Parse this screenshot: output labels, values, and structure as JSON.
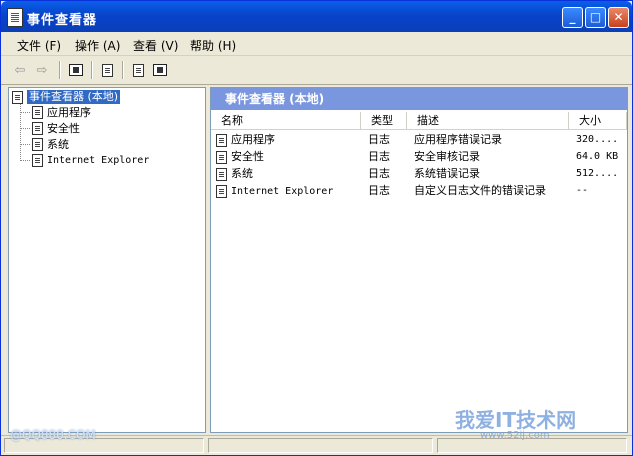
{
  "window": {
    "title": "事件查看器",
    "controls": [
      "_",
      "□",
      "✕"
    ]
  },
  "menu": [
    {
      "label": "文件 (F)"
    },
    {
      "label": "操作 (A)"
    },
    {
      "label": "查看 (V)"
    },
    {
      "label": "帮助 (H)"
    }
  ],
  "toolbar": {
    "back_glyph": "⇦",
    "forward_glyph": "⇨"
  },
  "tree": {
    "root": "事件查看器 (本地)",
    "children": [
      "应用程序",
      "安全性",
      "系统",
      "Internet Explorer"
    ]
  },
  "right_pane": {
    "header": "事件查看器 (本地)",
    "columns": [
      "名称",
      "类型",
      "描述",
      "大小"
    ],
    "rows": [
      {
        "name": "应用程序",
        "type": "日志",
        "desc": "应用程序错误记录",
        "size": "320...."
      },
      {
        "name": "安全性",
        "type": "日志",
        "desc": "安全审核记录",
        "size": "64.0 KB"
      },
      {
        "name": "系统",
        "type": "日志",
        "desc": "系统错误记录",
        "size": "512...."
      },
      {
        "name": "Internet Explorer",
        "type": "日志",
        "desc": "自定义日志文件的错误记录",
        "size": "--"
      }
    ]
  },
  "watermarks": {
    "left": "@QQ880.COM",
    "right": "我爱IT技术网",
    "right_sub": "www.52ij.com"
  },
  "colors": {
    "titlebar": "#0a5ee8",
    "selection": "#316ac5",
    "pane_header": "#7a96df"
  }
}
